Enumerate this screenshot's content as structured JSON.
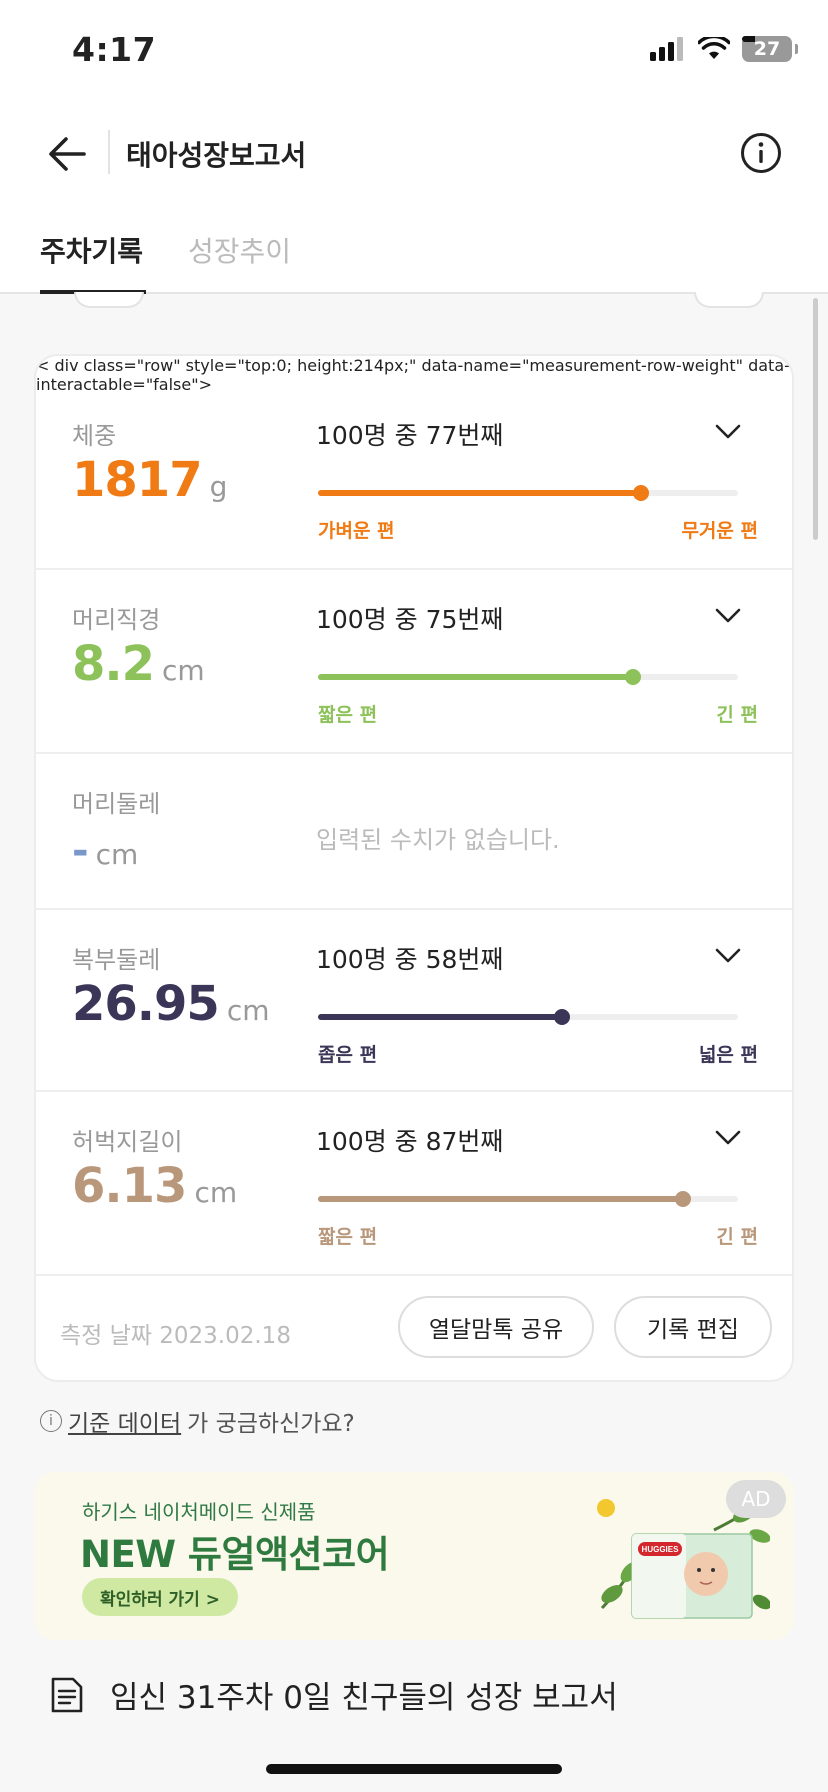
{
  "status_bar": {
    "time": "4:17",
    "battery": "27"
  },
  "header": {
    "title": "태아성장보고서"
  },
  "tabs": [
    {
      "label": "주차기록",
      "active": true
    },
    {
      "label": "성장추이",
      "active": false
    }
  ],
  "measurements": [
    {
      "label": "체중",
      "value": "1817",
      "unit": "g",
      "rank": "100명 중 77번째",
      "percentile": 0.77,
      "low_label": "가벼운 편",
      "high_label": "무거운 편",
      "color": "#f07a13"
    },
    {
      "label": "머리직경",
      "value": "8.2",
      "unit": "cm",
      "rank": "100명 중 75번째",
      "percentile": 0.75,
      "low_label": "짧은 편",
      "high_label": "긴 편",
      "color": "#8dc15a"
    },
    {
      "label": "머리둘레",
      "value": "-",
      "unit": "cm",
      "empty_text": "입력된 수치가 없습니다.",
      "color": "#7a97c9"
    },
    {
      "label": "복부둘레",
      "value": "26.95",
      "unit": "cm",
      "rank": "100명 중 58번째",
      "percentile": 0.58,
      "low_label": "좁은 편",
      "high_label": "넓은 편",
      "color": "#3b3557"
    },
    {
      "label": "허벅지길이",
      "value": "6.13",
      "unit": "cm",
      "rank": "100명 중 87번째",
      "percentile": 0.87,
      "low_label": "짧은 편",
      "high_label": "긴 편",
      "color": "#b8977a"
    }
  ],
  "card_footer": {
    "date_label": "측정 날짜 2023.02.18",
    "share_button": "열달맘톡 공유",
    "edit_button": "기록 편집"
  },
  "hint": {
    "link": "기준 데이터",
    "rest": "가 궁금하신가요?"
  },
  "ad": {
    "badge": "AD",
    "subtitle": "하기스 네이처메이드 신제품",
    "headline": "NEW 듀얼액션코어",
    "button": "확인하러 가기 >",
    "brand": "HUGGIES"
  },
  "report": {
    "text": "임신 31주차 0일 친구들의 성장 보고서"
  }
}
